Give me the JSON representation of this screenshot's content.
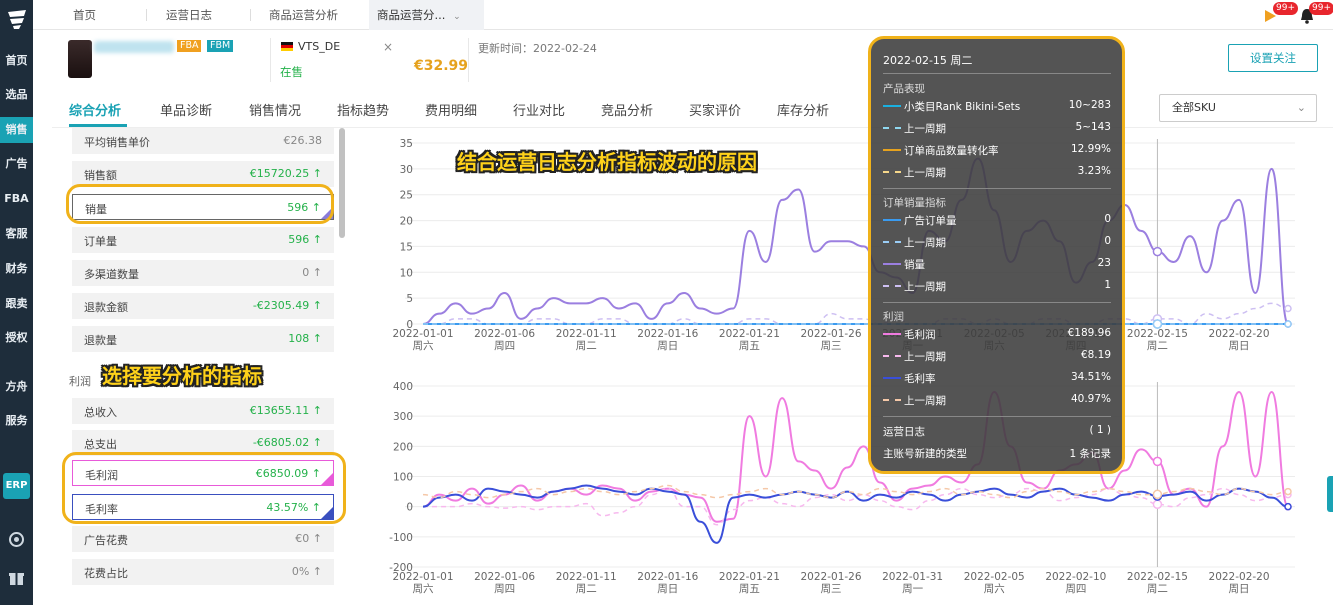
{
  "tabs": [
    {
      "label": "首页"
    },
    {
      "label": "运营日志"
    },
    {
      "label": "商品运营分析"
    },
    {
      "label": "商品运营分..."
    }
  ],
  "badges": {
    "flag": "99+",
    "bell": "99+"
  },
  "sidebar": {
    "items": [
      {
        "label": "首页"
      },
      {
        "label": "选品"
      },
      {
        "label": "销售"
      },
      {
        "label": "广告"
      },
      {
        "label": "FBA"
      },
      {
        "label": "客服"
      },
      {
        "label": "财务"
      },
      {
        "label": "跟卖"
      },
      {
        "label": "授权"
      },
      {
        "label": "方舟"
      },
      {
        "label": "服务"
      }
    ],
    "erp": "ERP"
  },
  "product": {
    "tags": [
      "FBA",
      "FBM"
    ],
    "account": "VTS_DE",
    "status": "在售",
    "price": "€32.99",
    "updated_label": "更新时间：",
    "updated_date": "2022-02-24",
    "follow_label": "设置关注"
  },
  "subtabs": [
    "综合分析",
    "单品诊断",
    "销售情况",
    "指标趋势",
    "费用明细",
    "行业对比",
    "竞品分析",
    "买家评价",
    "库存分析"
  ],
  "sku_select": "全部SKU",
  "metrics_sales": [
    {
      "label": "平均销售单价",
      "value": "€26.38",
      "trend": ""
    },
    {
      "label": "销售额",
      "value": "€15720.25",
      "trend": "↑"
    },
    {
      "label": "销量",
      "value": "596",
      "trend": "↑"
    },
    {
      "label": "订单量",
      "value": "596",
      "trend": "↑"
    },
    {
      "label": "多渠道数量",
      "value": "0",
      "trend": "↑"
    },
    {
      "label": "退款金额",
      "value": "-€2305.49",
      "trend": "↑"
    },
    {
      "label": "退款量",
      "value": "108",
      "trend": "↑"
    }
  ],
  "profit_label": "利润",
  "metrics_profit": [
    {
      "label": "总收入",
      "value": "€13655.11",
      "trend": "↑"
    },
    {
      "label": "总支出",
      "value": "-€6805.02",
      "trend": "↑"
    },
    {
      "label": "毛利润",
      "value": "€6850.09",
      "trend": "↑"
    },
    {
      "label": "毛利率",
      "value": "43.57%",
      "trend": "↑"
    },
    {
      "label": "广告花费",
      "value": "€0",
      "trend": "↑"
    },
    {
      "label": "花费占比",
      "value": "0%",
      "trend": "↑"
    }
  ],
  "callouts": {
    "top": "结合运营日志分析指标波动的原因",
    "left": "选择要分析的指标"
  },
  "tooltip": {
    "date": "2022-02-15 周二",
    "sections": [
      {
        "title": "产品表现",
        "rows": [
          {
            "name": "小类目Rank  Bikini-Sets",
            "value": "10~283",
            "color": "#1ab0e0",
            "dash": false
          },
          {
            "name": "上一周期",
            "value": "5~143",
            "color": "#8fd8f0",
            "dash": true
          },
          {
            "name": "订单商品数量转化率",
            "value": "12.99%",
            "color": "#e6a21e",
            "dash": false
          },
          {
            "name": "上一周期",
            "value": "3.23%",
            "color": "#f5d78a",
            "dash": true
          }
        ]
      },
      {
        "title": "订单销量指标",
        "rows": [
          {
            "name": "广告订单量",
            "value": "0",
            "color": "#3a9bf0",
            "dash": false
          },
          {
            "name": "上一周期",
            "value": "0",
            "color": "#9acdf6",
            "dash": true
          },
          {
            "name": "销量",
            "value": "23",
            "color": "#9b7fe0",
            "dash": false
          },
          {
            "name": "上一周期",
            "value": "1",
            "color": "#cdbff2",
            "dash": true
          }
        ]
      },
      {
        "title": "利润",
        "rows": [
          {
            "name": "毛利润",
            "value": "€189.96",
            "color": "#f07be0",
            "dash": false
          },
          {
            "name": "上一周期",
            "value": "€8.19",
            "color": "#f7b9ee",
            "dash": true
          },
          {
            "name": "毛利率",
            "value": "34.51%",
            "color": "#3a4fd9",
            "dash": false
          },
          {
            "name": "上一周期",
            "value": "40.97%",
            "color": "#f5c8a8",
            "dash": true
          }
        ]
      }
    ],
    "log_label": "运营日志",
    "log_count": "( 1 )",
    "log_type": "主账号新建的类型",
    "log_records": "1 条记录"
  },
  "chart_data": [
    {
      "type": "line",
      "x": [
        "2022-01-01",
        "2022-01-02",
        "2022-01-03",
        "2022-01-04",
        "2022-01-05",
        "2022-01-06",
        "2022-01-07",
        "2022-01-08",
        "2022-01-09",
        "2022-01-10",
        "2022-01-11",
        "2022-01-12",
        "2022-01-13",
        "2022-01-14",
        "2022-01-15",
        "2022-01-16",
        "2022-01-17",
        "2022-01-18",
        "2022-01-19",
        "2022-01-20",
        "2022-01-21",
        "2022-01-22",
        "2022-01-23",
        "2022-01-24",
        "2022-01-25",
        "2022-01-26",
        "2022-01-27",
        "2022-01-28",
        "2022-01-29",
        "2022-01-30",
        "2022-01-31",
        "2022-02-01",
        "2022-02-02",
        "2022-02-03",
        "2022-02-04",
        "2022-02-05",
        "2022-02-06",
        "2022-02-07",
        "2022-02-08",
        "2022-02-09",
        "2022-02-10",
        "2022-02-11",
        "2022-02-12",
        "2022-02-13",
        "2022-02-14",
        "2022-02-15",
        "2022-02-16",
        "2022-02-17",
        "2022-02-18",
        "2022-02-19",
        "2022-02-20",
        "2022-02-21",
        "2022-02-22",
        "2022-02-23"
      ],
      "xticks": [
        {
          "date": "2022-01-01",
          "day": "周六"
        },
        {
          "date": "2022-01-06",
          "day": "周四"
        },
        {
          "date": "2022-01-11",
          "day": "周二"
        },
        {
          "date": "2022-01-16",
          "day": "周日"
        },
        {
          "date": "2022-01-21",
          "day": "周五"
        },
        {
          "date": "2022-01-26",
          "day": "周三"
        },
        {
          "date": "2022-01-31",
          "day": "周一"
        },
        {
          "date": "2022-02-05",
          "day": "周六"
        },
        {
          "date": "2022-02-10",
          "day": "周四"
        },
        {
          "date": "2022-02-15",
          "day": "周二"
        },
        {
          "date": "2022-02-20",
          "day": "周日"
        }
      ],
      "ylim": [
        0,
        35
      ],
      "yticks": [
        0,
        5,
        10,
        15,
        20,
        25,
        30,
        35
      ],
      "series": [
        {
          "values": [
            0,
            2,
            4,
            2,
            3,
            6,
            1,
            3,
            5,
            4,
            4,
            5,
            3,
            4,
            1,
            4,
            6,
            3,
            2,
            3,
            18,
            12,
            24,
            26,
            14,
            16,
            16,
            15,
            10,
            9,
            6,
            18,
            16,
            24,
            32,
            22,
            12,
            18,
            20,
            16,
            8,
            12,
            20,
            23,
            18,
            14,
            12,
            17,
            10,
            20,
            24,
            6,
            30,
            0
          ],
          "color": "#9b7fe0",
          "dash": false
        },
        {
          "values": [
            0,
            0,
            1,
            1,
            0,
            0,
            0,
            1,
            1,
            0,
            0,
            1,
            1,
            0,
            0,
            0,
            1,
            0,
            0,
            0,
            1,
            1,
            0,
            0,
            0,
            2,
            1,
            1,
            0,
            1,
            0,
            0,
            1,
            1,
            0,
            1,
            0,
            0,
            1,
            1,
            0,
            0,
            1,
            1,
            0,
            1,
            1,
            0,
            2,
            1,
            2,
            3,
            4,
            3
          ],
          "color": "#cdbff2",
          "dash": true
        },
        {
          "values": [
            0,
            0,
            0,
            0,
            0,
            0,
            0,
            0,
            0,
            0,
            0,
            0,
            0,
            0,
            0,
            0,
            0,
            0,
            0,
            0,
            0,
            0,
            0,
            0,
            0,
            0,
            0,
            0,
            0,
            0,
            0,
            0,
            0,
            0,
            0,
            0,
            0,
            0,
            0,
            0,
            0,
            0,
            0,
            0,
            0,
            0,
            0,
            0,
            0,
            0,
            0,
            0,
            0,
            0
          ],
          "color": "#3a9bf0",
          "dash": false
        },
        {
          "values": [
            0,
            0,
            0,
            0,
            0,
            0,
            0,
            0,
            0,
            0,
            0,
            0,
            0,
            0,
            0,
            0,
            0,
            0,
            0,
            0,
            0,
            0,
            0,
            0,
            0,
            0,
            0,
            0,
            0,
            0,
            0,
            0,
            0,
            0,
            0,
            0,
            0,
            0,
            0,
            0,
            0,
            0,
            0,
            0,
            0,
            0,
            0,
            0,
            0,
            0,
            0,
            0,
            0,
            0
          ],
          "color": "#9acdf6",
          "dash": true
        }
      ]
    },
    {
      "type": "line",
      "x_ref": "same as chart 1",
      "ylim": [
        -200,
        400
      ],
      "yticks": [
        -200,
        -100,
        0,
        100,
        200,
        300,
        400
      ],
      "series": [
        {
          "values": [
            0,
            40,
            20,
            60,
            10,
            40,
            70,
            20,
            50,
            60,
            40,
            70,
            60,
            20,
            50,
            60,
            40,
            30,
            -50,
            -40,
            300,
            100,
            360,
            150,
            120,
            60,
            130,
            200,
            80,
            20,
            60,
            70,
            100,
            80,
            140,
            380,
            200,
            80,
            60,
            120,
            140,
            180,
            60,
            120,
            190,
            150,
            40,
            60,
            0,
            200,
            380,
            100,
            380,
            0
          ],
          "color": "#f07be0",
          "dash": false
        },
        {
          "values": [
            0,
            0,
            0,
            10,
            0,
            -5,
            0,
            -10,
            0,
            0,
            10,
            -30,
            -20,
            0,
            40,
            60,
            0,
            0,
            -60,
            -10,
            20,
            30,
            10,
            0,
            30,
            40,
            20,
            40,
            20,
            0,
            -10,
            20,
            40,
            60,
            40,
            30,
            40,
            60,
            50,
            20,
            30,
            40,
            60,
            40,
            30,
            8,
            0,
            30,
            40,
            60,
            40,
            20,
            30,
            40
          ],
          "color": "#f7b9ee",
          "dash": true
        },
        {
          "values": [
            0,
            30,
            40,
            20,
            60,
            50,
            40,
            30,
            50,
            60,
            70,
            60,
            50,
            40,
            60,
            50,
            40,
            -50,
            -120,
            30,
            40,
            30,
            40,
            50,
            40,
            30,
            50,
            20,
            40,
            30,
            50,
            40,
            20,
            40,
            50,
            60,
            40,
            30,
            50,
            60,
            40,
            30,
            20,
            40,
            50,
            35,
            40,
            50,
            20,
            40,
            60,
            50,
            30,
            0
          ],
          "color": "#3a4fd9",
          "dash": false
        },
        {
          "values": [
            40,
            30,
            50,
            40,
            30,
            40,
            50,
            60,
            40,
            50,
            60,
            50,
            40,
            50,
            60,
            70,
            50,
            40,
            30,
            40,
            50,
            60,
            40,
            50,
            40,
            30,
            50,
            40,
            60,
            50,
            40,
            50,
            60,
            40,
            50,
            40,
            30,
            50,
            60,
            50,
            40,
            50,
            60,
            50,
            40,
            41,
            50,
            60,
            50,
            40,
            60,
            50,
            40,
            50
          ],
          "color": "#f5c8a8",
          "dash": true
        }
      ]
    }
  ]
}
